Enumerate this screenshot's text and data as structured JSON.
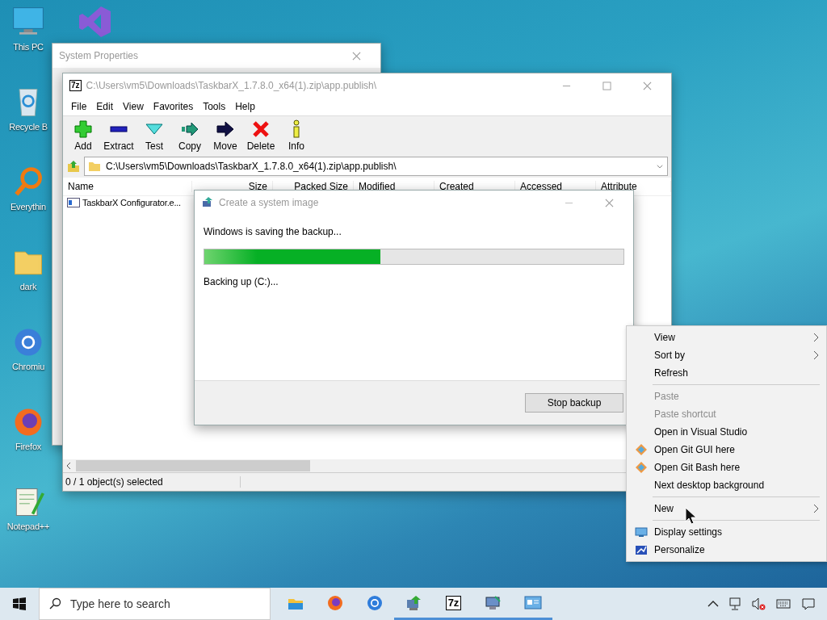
{
  "desktop": {
    "icons": [
      {
        "label": "This PC"
      },
      {
        "label": "Recycle B"
      },
      {
        "label": "Everythin"
      },
      {
        "label": "dark"
      },
      {
        "label": "Chromiu"
      },
      {
        "label": "Firefox"
      },
      {
        "label": "Notepad++"
      }
    ]
  },
  "system_properties": {
    "title": "System Properties"
  },
  "archive_window": {
    "icon_text": "7z",
    "title": "C:\\Users\\vm5\\Downloads\\TaskbarX_1.7.8.0_x64(1).zip\\app.publish\\",
    "menu": [
      "File",
      "Edit",
      "View",
      "Favorites",
      "Tools",
      "Help"
    ],
    "toolbar": [
      "Add",
      "Extract",
      "Test",
      "Copy",
      "Move",
      "Delete",
      "Info"
    ],
    "address": "C:\\Users\\vm5\\Downloads\\TaskbarX_1.7.8.0_x64(1).zip\\app.publish\\",
    "columns": [
      "Name",
      "Size",
      "Packed Size",
      "Modified",
      "Created",
      "Accessed",
      "Attribute"
    ],
    "rows": [
      {
        "name": "TaskbarX Configurator.e..."
      }
    ],
    "status": "0 / 1 object(s) selected"
  },
  "backup_dialog": {
    "title": "Create a system image",
    "message": "Windows is saving the backup...",
    "progress": {
      "level": 0.42
    },
    "detail": "Backing up (C:)...",
    "button": "Stop backup"
  },
  "context_menu": {
    "items": [
      {
        "kind": "item",
        "label": "View",
        "disabled": false,
        "submenu": true
      },
      {
        "kind": "item",
        "label": "Sort by",
        "disabled": false,
        "submenu": true
      },
      {
        "kind": "item",
        "label": "Refresh",
        "disabled": false,
        "submenu": false
      },
      {
        "kind": "separator"
      },
      {
        "kind": "item",
        "label": "Paste",
        "disabled": true,
        "submenu": false
      },
      {
        "kind": "item",
        "label": "Paste shortcut",
        "disabled": true,
        "submenu": false
      },
      {
        "kind": "item",
        "label": "Open in Visual Studio",
        "disabled": false,
        "submenu": false
      },
      {
        "kind": "item",
        "label": "Open Git GUI here",
        "disabled": false,
        "submenu": false
      },
      {
        "kind": "item",
        "label": "Open Git Bash here",
        "disabled": false,
        "submenu": false
      },
      {
        "kind": "item",
        "label": "Next desktop background",
        "disabled": false,
        "submenu": false
      },
      {
        "kind": "separator"
      },
      {
        "kind": "item",
        "label": "New",
        "disabled": false,
        "submenu": true
      },
      {
        "kind": "separator"
      },
      {
        "kind": "item",
        "label": "Display settings",
        "disabled": false,
        "submenu": false
      },
      {
        "kind": "item",
        "label": "Personalize",
        "disabled": false,
        "submenu": false
      }
    ]
  },
  "taskbar": {
    "search": {
      "placeholder": "Type here to search"
    },
    "apps": [
      {
        "running": false
      },
      {
        "running": false
      },
      {
        "running": false
      },
      {
        "running": true
      },
      {
        "running": true,
        "label": "7z"
      },
      {
        "running": true
      },
      {
        "running": true
      }
    ]
  }
}
